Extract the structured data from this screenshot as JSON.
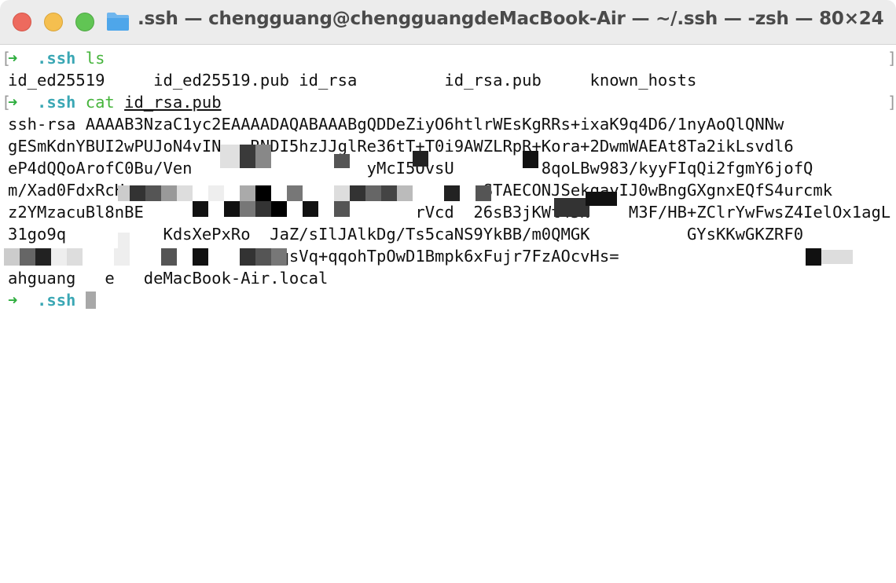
{
  "window": {
    "title": ".ssh — chengguang@chengguangdeMacBook-Air — ~/.ssh — -zsh — 80×24"
  },
  "prompt": {
    "arrow": "➜",
    "dir": ".ssh"
  },
  "session": {
    "cmd1": "ls",
    "ls_output": "id_ed25519     id_ed25519.pub id_rsa         id_rsa.pub     known_hosts",
    "cmd2_name": "cat",
    "cmd2_arg": "id_rsa.pub",
    "key_lines": [
      "ssh-rsa AAAAB3NzaC1yc2EAAAADAQABAAABgQDDeZiyO6htlrWEsKgRRs+ixaK9q4D6/1nyAoQlQNNw",
      "gESmKdnYBUI2wPUJoN4vIN   RNDI5hzJJglRe36tT+T0i9AWZLRpR+Kora+2DwmWAEAt8Ta2ikLsvdl6",
      "eP4dQQoArofC0Bu/Ven                  yMcI5OvsU         8qoLBw983/kyyFIqQi2fgmY6jofQ",
      "m/Xad0FdxRcH                                     STAECONJSekqayIJ0wBngGXgnxEQfS4urcmk",
      "z2YMzacuBl8nBE                            rVcd  26sB3jKWt45N    M3F/HB+ZClrYwFwsZ4IelOx1agL",
      "31go9q          KdsXePxRo  JaZ/sIlJAlkDg/Ts5caNS9YkBB/m0QMGK          GYsKKwGKZRF0",
      "                        /yZSqsVq+qqohTpOwD1Bmpk6xFujr7FzAOcvHs=",
      "ahguang   e   deMacBook-Air.local"
    ]
  },
  "colors": {
    "arrow": "#2fae3f",
    "dir": "#3aa7b4",
    "command": "#46b43c"
  }
}
